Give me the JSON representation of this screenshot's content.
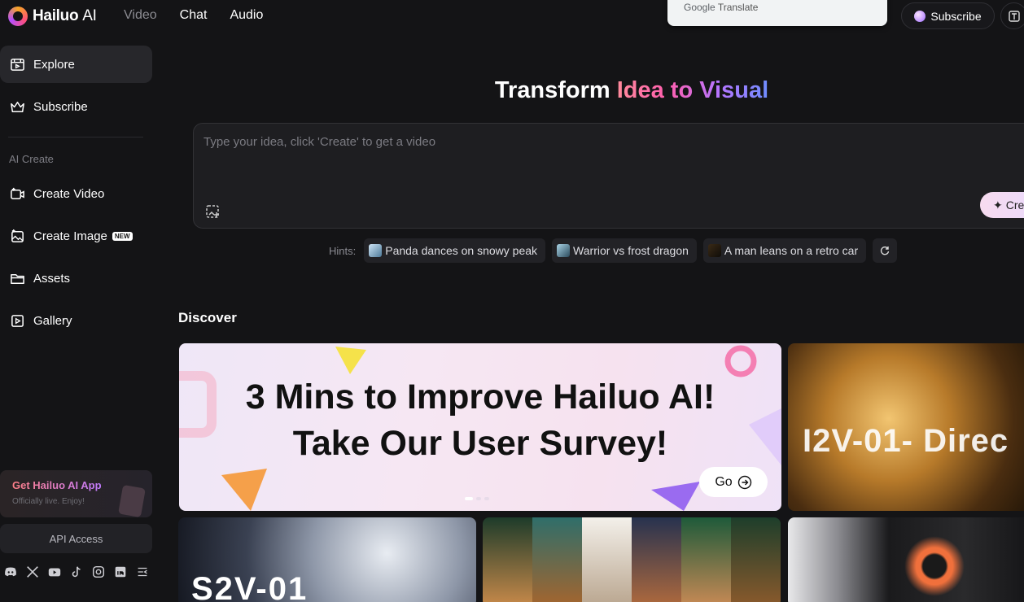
{
  "header": {
    "brand": "Hailuo",
    "brand_suffix": "AI",
    "nav": [
      {
        "label": "Video",
        "active": false
      },
      {
        "label": "Chat",
        "active": true
      },
      {
        "label": "Audio",
        "active": true
      }
    ],
    "google_translate_google": "Google",
    "google_translate_translate": "Translate",
    "subscribe_label": "Subscribe"
  },
  "sidebar": {
    "items": [
      {
        "label": "Explore",
        "icon": "explore-icon"
      },
      {
        "label": "Subscribe",
        "icon": "crown-icon"
      }
    ],
    "section_label": "AI Create",
    "create_items": [
      {
        "label": "Create Video",
        "icon": "video-create-icon"
      },
      {
        "label": "Create Image",
        "icon": "image-create-icon",
        "badge": "NEW"
      },
      {
        "label": "Assets",
        "icon": "folder-icon"
      },
      {
        "label": "Gallery",
        "icon": "gallery-icon"
      }
    ],
    "app_card": {
      "title": "Get Hailuo AI App",
      "subtitle": "Officially live. Enjoy!"
    },
    "api_access": "API Access",
    "socials": [
      "discord-icon",
      "x-icon",
      "youtube-icon",
      "tiktok-icon",
      "instagram-icon",
      "linkedin-icon",
      "collapse-icon"
    ]
  },
  "main": {
    "title_plain": "Transform ",
    "title_grad": "Idea to Visual",
    "prompt_placeholder": "Type your idea, click 'Create' to get a video",
    "create_label": "Cre",
    "hints_label": "Hints:",
    "hints": [
      "Panda dances on snowy peak",
      "Warrior vs frost dragon",
      "A man leans on a retro car"
    ],
    "discover_label": "Discover",
    "banner": {
      "line1": "3 Mins to Improve Hailuo AI!",
      "line2": "Take Our User Survey!",
      "go_label": "Go"
    },
    "cards": {
      "i2v_label": "I2V-01-  Direc",
      "s2v_label": "S2V-01"
    }
  },
  "colors": {
    "background": "#141416",
    "accent_pink": "#ff5fae",
    "accent_purple": "#b774ff"
  }
}
